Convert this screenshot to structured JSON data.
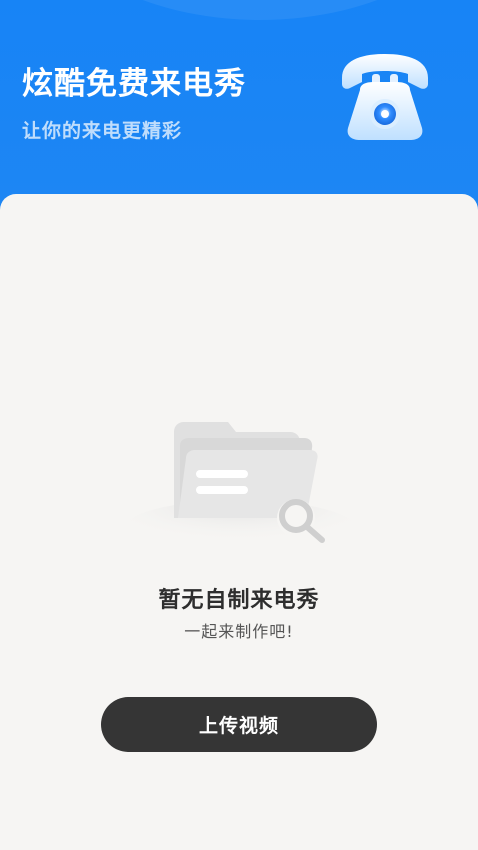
{
  "header": {
    "title": "炫酷免费来电秀",
    "subtitle": "让你的来电更精彩",
    "icon": "telephone-icon"
  },
  "empty_state": {
    "icon": "empty-folder-search-icon",
    "title": "暂无自制来电秀",
    "subtitle": "一起来制作吧!"
  },
  "actions": {
    "upload_label": "上传视频"
  },
  "colors": {
    "header_blue": "#1784f6",
    "content_background": "#f6f5f3",
    "button_dark": "#353535"
  }
}
